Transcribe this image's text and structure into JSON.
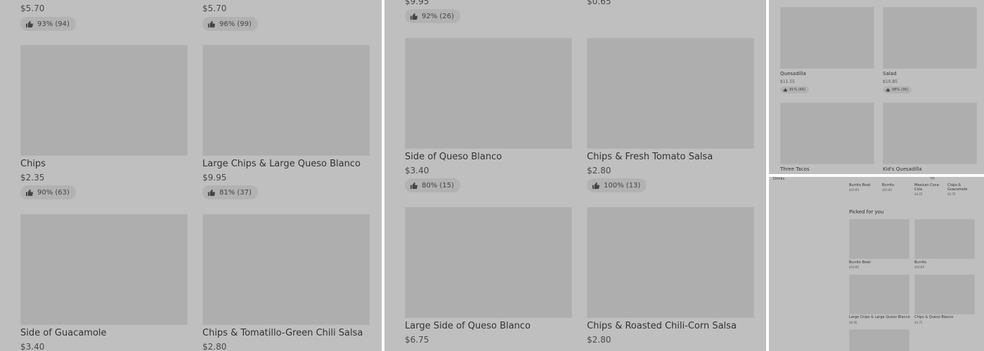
{
  "panel1": {
    "top_items": [
      {
        "price": "$5.70",
        "rating": "93% (94)"
      },
      {
        "price": "$5.70",
        "rating": "96% (99)"
      }
    ],
    "items": [
      {
        "name": "Chips",
        "price": "$2.35",
        "rating": "90% (63)"
      },
      {
        "name": "Large Chips & Large Queso Blanco",
        "price": "$9.95",
        "rating": "81% (37)"
      },
      {
        "name": "Side of Guacamole",
        "price": "$3.40"
      },
      {
        "name": "Chips & Tomatillo-Green Chili Salsa",
        "price": "$2.80"
      }
    ]
  },
  "panel2": {
    "top_items": [
      {
        "price": "$9.95",
        "rating": "92% (26)"
      },
      {
        "price": "$0.65"
      }
    ],
    "items": [
      {
        "name": "Side of Queso Blanco",
        "price": "$3.40",
        "rating": "80% (15)"
      },
      {
        "name": "Chips & Fresh Tomato Salsa",
        "price": "$2.80",
        "rating": "100% (13)"
      },
      {
        "name": "Large Side of Queso Blanco",
        "price": "$6.75"
      },
      {
        "name": "Chips & Roasted Chili-Corn Salsa",
        "price": "$2.80"
      }
    ]
  },
  "panel3": {
    "items": [
      {
        "name": "Quesadilla",
        "price": "$11.55",
        "rating": "81% (66)"
      },
      {
        "name": "Salad",
        "price": "$10.85",
        "rating": "98% (36)"
      },
      {
        "name": "Three Tacos"
      },
      {
        "name": "Kid's Quesadilla"
      }
    ]
  },
  "panel4": {
    "side_label": "Drinks",
    "strip": [
      {
        "name": "Burrito Bowl",
        "price": "$10.85"
      },
      {
        "name": "Burrito",
        "price": "$10.85"
      },
      {
        "name": "Mexican Coca-Cola",
        "price": "$4.25"
      },
      {
        "name": "Chips & Guacamole",
        "price": "$5.70"
      }
    ],
    "section_title": "Picked for you",
    "items": [
      {
        "name": "Burrito Bowl",
        "price": "$10.85"
      },
      {
        "name": "Burrito",
        "price": "$10.85"
      },
      {
        "name": "Large Chips & Large Queso Blanco",
        "price": "$9.95"
      },
      {
        "name": "Chips & Queso Blanco",
        "price": "$5.75"
      }
    ]
  }
}
